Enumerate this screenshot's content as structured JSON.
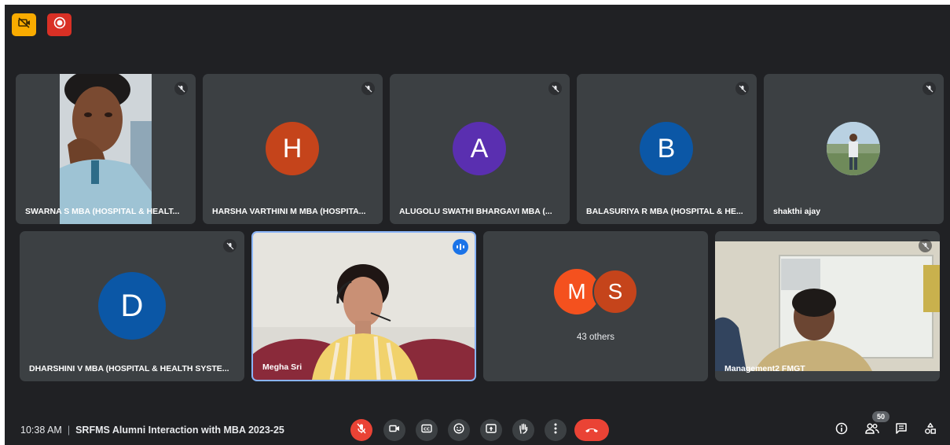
{
  "top_badges": [
    {
      "icon": "camera-off-icon",
      "color": "#f9ab00"
    },
    {
      "icon": "record-icon",
      "color": "#d93025"
    }
  ],
  "participants": [
    {
      "name": "SWARNA S MBA (HOSPITAL & HEALT...",
      "type": "video",
      "muted": true
    },
    {
      "name": "HARSHA VARTHINI M MBA (HOSPITA...",
      "type": "avatar",
      "initial": "H",
      "avatar_color": "#c5441b",
      "muted": true
    },
    {
      "name": "ALUGOLU SWATHI BHARGAVI MBA (...",
      "type": "avatar",
      "initial": "A",
      "avatar_color": "#5a2fb0",
      "muted": true
    },
    {
      "name": "BALASURIYA R MBA (HOSPITAL & HE...",
      "type": "avatar",
      "initial": "B",
      "avatar_color": "#0b57a6",
      "muted": true
    },
    {
      "name": "shakthi ajay",
      "type": "photo-avatar",
      "muted": true
    },
    {
      "name": "DHARSHINI V MBA (HOSPITAL & HEALTH SYSTE...",
      "type": "avatar",
      "initial": "D",
      "avatar_color": "#0b57a6",
      "muted": true
    },
    {
      "name": "Megha Sri",
      "type": "video",
      "speaking": true
    },
    {
      "name": "Management2 FMGT",
      "type": "video",
      "muted": true
    }
  ],
  "others_tile": {
    "avatars": [
      {
        "initial": "M",
        "color": "#f4511e"
      },
      {
        "initial": "S",
        "color": "#c5441b"
      }
    ],
    "label": "43 others"
  },
  "bottom_bar": {
    "time": "10:38 AM",
    "separator": "|",
    "meeting_title": "SRFMS Alumni Interaction with MBA 2023-25",
    "controls": [
      "mic-off-icon",
      "camera-icon",
      "captions-icon",
      "emoji-icon",
      "present-icon",
      "raise-hand-icon",
      "more-options-icon",
      "end-call-icon"
    ],
    "right_controls": [
      "info-icon",
      "people-icon",
      "chat-icon",
      "activities-icon"
    ],
    "participant_count": "50"
  },
  "colors": {
    "background": "#202124",
    "tile": "#3c4043",
    "active_border": "#8ab4f8",
    "end_call": "#ea4335"
  }
}
